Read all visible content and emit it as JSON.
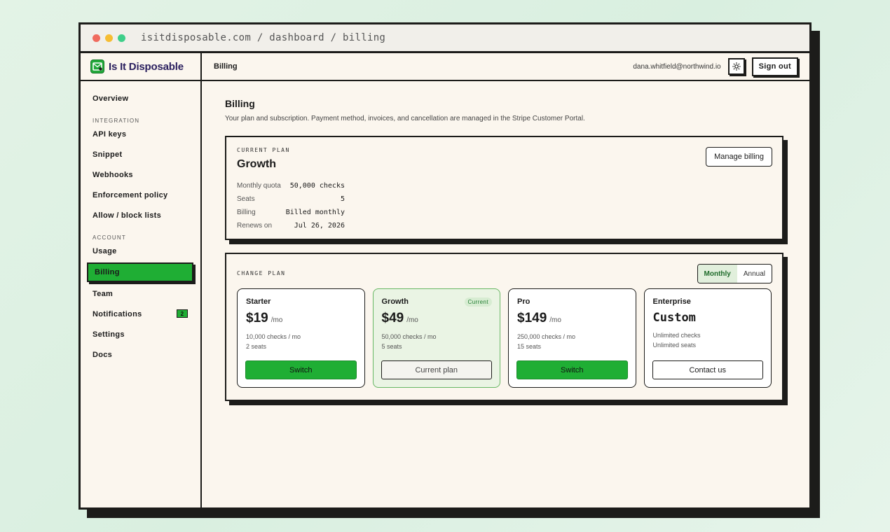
{
  "browser": {
    "url": "isitdisposable.com / dashboard / billing"
  },
  "brand": {
    "name": "Is It Disposable",
    "icon": "mail-check-icon",
    "colors": {
      "accent": "#1fae34",
      "ink": "#1c1c1a",
      "paper": "#fbf6ee",
      "brand_text": "#2a1f5e"
    }
  },
  "sidebar": {
    "overview": "Overview",
    "section_integration": "INTEGRATION",
    "api_keys": "API keys",
    "snippet": "Snippet",
    "webhooks": "Webhooks",
    "enforcement_policy": "Enforcement policy",
    "allow_block_lists": "Allow / block lists",
    "section_account": "ACCOUNT",
    "usage": "Usage",
    "billing": "Billing",
    "team": "Team",
    "notifications": "Notifications",
    "notifications_badge": "2",
    "settings": "Settings",
    "docs": "Docs"
  },
  "topbar": {
    "title": "Billing",
    "email": "dana.whitfield@northwind.io",
    "theme_icon": "sun-icon",
    "sign_out": "Sign out"
  },
  "page": {
    "title": "Billing",
    "subtitle": "Your plan and subscription. Payment method, invoices, and cancellation are managed in the Stripe Customer Portal."
  },
  "current_plan": {
    "eyebrow": "CURRENT PLAN",
    "name": "Growth",
    "manage_button": "Manage billing",
    "rows": [
      {
        "label": "Monthly quota",
        "value": "50,000 checks"
      },
      {
        "label": "Seats",
        "value": "5"
      },
      {
        "label": "Billing",
        "value": "Billed monthly"
      },
      {
        "label": "Renews on",
        "value": "Jul 26, 2026"
      }
    ]
  },
  "change_plan": {
    "eyebrow": "CHANGE PLAN",
    "toggle": {
      "monthly": "Monthly",
      "annual": "Annual",
      "selected": "Monthly"
    },
    "plans": [
      {
        "name": "Starter",
        "price": "$19",
        "per": "/mo",
        "features": [
          "10,000 checks / mo",
          "2 seats"
        ],
        "button": "Switch",
        "button_style": "primary"
      },
      {
        "name": "Growth",
        "tag": "Current",
        "price": "$49",
        "per": "/mo",
        "features": [
          "50,000 checks / mo",
          "5 seats"
        ],
        "button": "Current plan",
        "button_style": "disabled"
      },
      {
        "name": "Pro",
        "price": "$149",
        "per": "/mo",
        "features": [
          "250,000 checks / mo",
          "15 seats"
        ],
        "button": "Switch",
        "button_style": "primary"
      },
      {
        "name": "Enterprise",
        "price": "Custom",
        "features": [
          "Unlimited checks",
          "Unlimited seats"
        ],
        "button": "Contact us",
        "button_style": "outline"
      }
    ]
  }
}
